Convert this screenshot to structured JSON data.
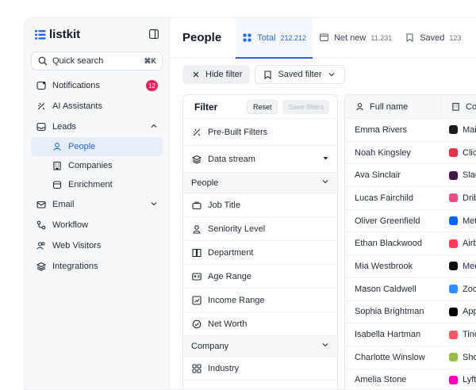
{
  "app": {
    "name": "listkit"
  },
  "sidebar": {
    "search": {
      "placeholder": "Quick search",
      "shortcut": "⌘K"
    },
    "items": [
      {
        "label": "Notifications",
        "icon": "bell-icon",
        "badge": "12"
      },
      {
        "label": "AI Assistants",
        "icon": "sparkle-icon"
      },
      {
        "label": "Leads",
        "icon": "inbox-icon",
        "expanded": true
      },
      {
        "label": "People",
        "icon": "user-icon",
        "active": true
      },
      {
        "label": "Companies",
        "icon": "building-icon"
      },
      {
        "label": "Enrichment",
        "icon": "database-icon"
      },
      {
        "label": "Email",
        "icon": "mail-icon",
        "expanded": false
      },
      {
        "label": "Workflow",
        "icon": "workflow-icon"
      },
      {
        "label": "Web Visitors",
        "icon": "users-icon"
      },
      {
        "label": "Integrations",
        "icon": "layers-icon"
      }
    ]
  },
  "header": {
    "title": "People",
    "tabs": [
      {
        "label": "Total",
        "count": "212.212",
        "active": true
      },
      {
        "label": "Net new",
        "count": "11.231"
      },
      {
        "label": "Saved",
        "count": "123"
      }
    ]
  },
  "toolbar": {
    "hide_filter": "Hide filter",
    "saved_filter": "Saved filter"
  },
  "filter": {
    "title": "Filter",
    "reset": "Reset",
    "save": "Save filters",
    "prebuilt": "Pre-Built Filters",
    "data_stream": "Data stream",
    "group_people": "People",
    "people_items": [
      "Job Title",
      "Seniority Level",
      "Department",
      "Age Range",
      "Income Range",
      "Net Worth"
    ],
    "group_company": "Company",
    "company_items": [
      "Industry"
    ]
  },
  "table": {
    "col_name": "Full name",
    "col_company": "Co",
    "rows": [
      {
        "name": "Emma Rivers",
        "company": "Mai",
        "color": "#1c1c1c"
      },
      {
        "name": "Noah Kingsley",
        "company": "Clic",
        "color": "#e2334a"
      },
      {
        "name": "Ava Sinclair",
        "company": "Slac",
        "color": "#4a154b"
      },
      {
        "name": "Lucas Fairchild",
        "company": "Drib",
        "color": "#ea4c89"
      },
      {
        "name": "Oliver Greenfield",
        "company": "Met",
        "color": "#0866ff"
      },
      {
        "name": "Ethan Blackwood",
        "company": "Airb",
        "color": "#ff385c"
      },
      {
        "name": "Mia Westbrook",
        "company": "Med",
        "color": "#111111"
      },
      {
        "name": "Mason Caldwell",
        "company": "Zoo",
        "color": "#2d8cff"
      },
      {
        "name": "Sophia Brightman",
        "company": "App",
        "color": "#000000"
      },
      {
        "name": "Isabella Hartman",
        "company": "Tind",
        "color": "#fd5564"
      },
      {
        "name": "Charlotte Winslow",
        "company": "Sho",
        "color": "#95bf47"
      },
      {
        "name": "Amelia Stone",
        "company": "Lyft",
        "color": "#ff00bf"
      }
    ]
  }
}
